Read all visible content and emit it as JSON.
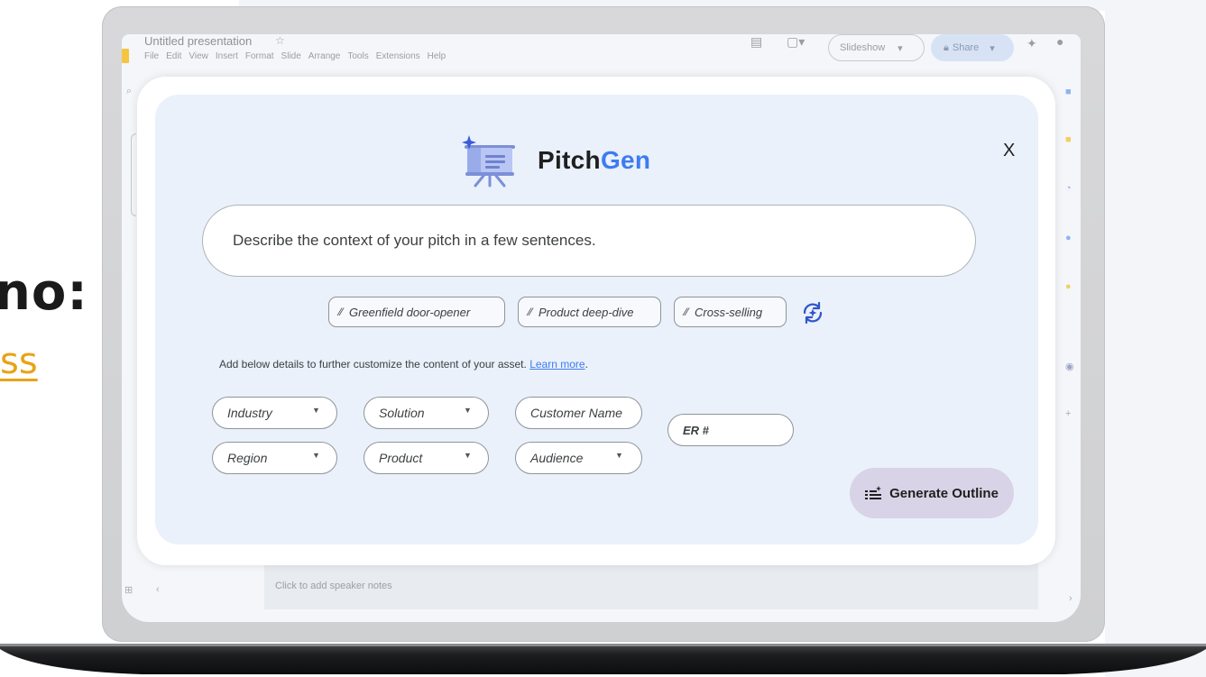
{
  "side_text": {
    "heading": "no:",
    "link": "ss"
  },
  "slides_app": {
    "doc_title": "Untitled presentation",
    "menu": [
      "File",
      "Edit",
      "View",
      "Insert",
      "Format",
      "Slide",
      "Arrange",
      "Tools",
      "Extensions",
      "Help"
    ],
    "slideshow_label": "Slideshow",
    "share_label": "Share",
    "speaker_notes_placeholder": "Click to add speaker notes"
  },
  "pitchgen": {
    "close_label": "X",
    "brand": {
      "part1": "Pitch",
      "part2": "Gen"
    },
    "context_placeholder": "Describe the context of your pitch in a few sentences.",
    "chips": [
      "Greenfield door-opener",
      "Product deep-dive",
      "Cross-selling"
    ],
    "details_text": "Add below details to further customize the content of your asset.",
    "learn_more": "Learn more",
    "details_suffix": ".",
    "dropdowns": {
      "industry": "Industry",
      "solution": "Solution",
      "region": "Region",
      "product": "Product",
      "audience": "Audience"
    },
    "customer_name_placeholder": "Customer Name",
    "er_placeholder": "ER #",
    "generate_label": "Generate Outline"
  },
  "colors": {
    "accent": "#3d7bf2",
    "panel": "#eaf1fb",
    "button": "#d8d3e6",
    "link_yellow": "#e8a317"
  }
}
